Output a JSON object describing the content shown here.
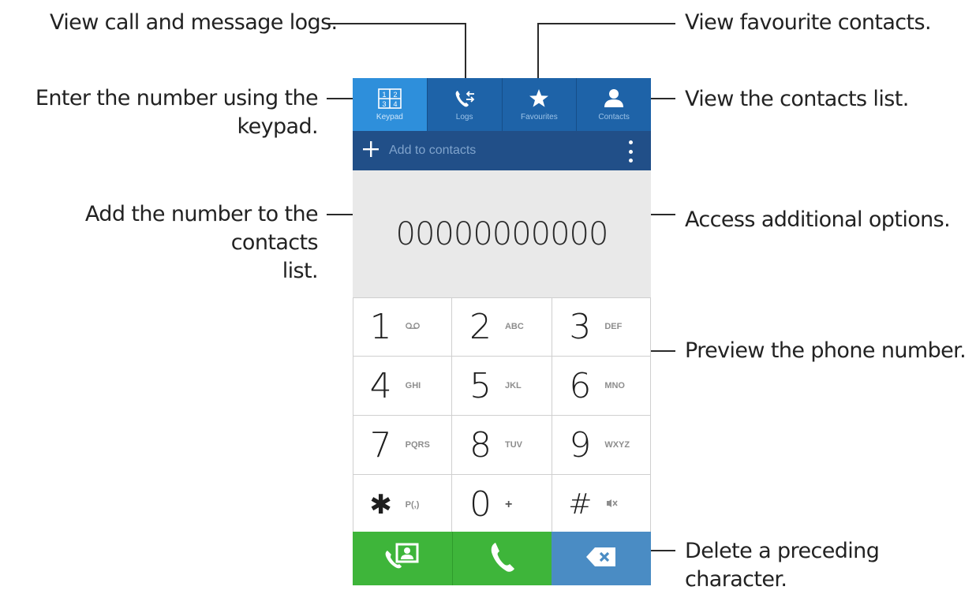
{
  "callouts": {
    "logs": "View call and message logs.",
    "favourites": "View favourite contacts.",
    "keypad_line1": "Enter the number using the",
    "keypad_line2": "keypad.",
    "contacts_list": "View the contacts list.",
    "add_line1": "Add the number to the contacts",
    "add_line2": "list.",
    "options": "Access additional options.",
    "preview": "Preview the phone number.",
    "delete": "Delete a preceding character."
  },
  "tabs": [
    {
      "label": "Keypad",
      "icon": "keypad-icon"
    },
    {
      "label": "Logs",
      "icon": "logs-icon"
    },
    {
      "label": "Favourites",
      "icon": "star-icon"
    },
    {
      "label": "Contacts",
      "icon": "contact-person-icon"
    }
  ],
  "action_bar": {
    "add_label": "Add to contacts"
  },
  "number_display": "00000000000",
  "keys": [
    [
      {
        "digit": "1",
        "letters": ""
      },
      {
        "digit": "2",
        "letters": "ABC"
      },
      {
        "digit": "3",
        "letters": "DEF"
      }
    ],
    [
      {
        "digit": "4",
        "letters": "GHI"
      },
      {
        "digit": "5",
        "letters": "JKL"
      },
      {
        "digit": "6",
        "letters": "MNO"
      }
    ],
    [
      {
        "digit": "7",
        "letters": "PQRS"
      },
      {
        "digit": "8",
        "letters": "TUV"
      },
      {
        "digit": "9",
        "letters": "WXYZ"
      }
    ],
    [
      {
        "digit": "✱",
        "letters": "P(,)"
      },
      {
        "digit": "0",
        "letters": "+"
      },
      {
        "digit": "#",
        "letters": ""
      }
    ]
  ],
  "colors": {
    "tab_bar": "#1e63a8",
    "tab_active": "#2e8fdb",
    "action_bar": "#214f88",
    "number_area": "#e9e9e9",
    "call_green": "#3eb53a",
    "delete_blue": "#4a8cc4"
  }
}
